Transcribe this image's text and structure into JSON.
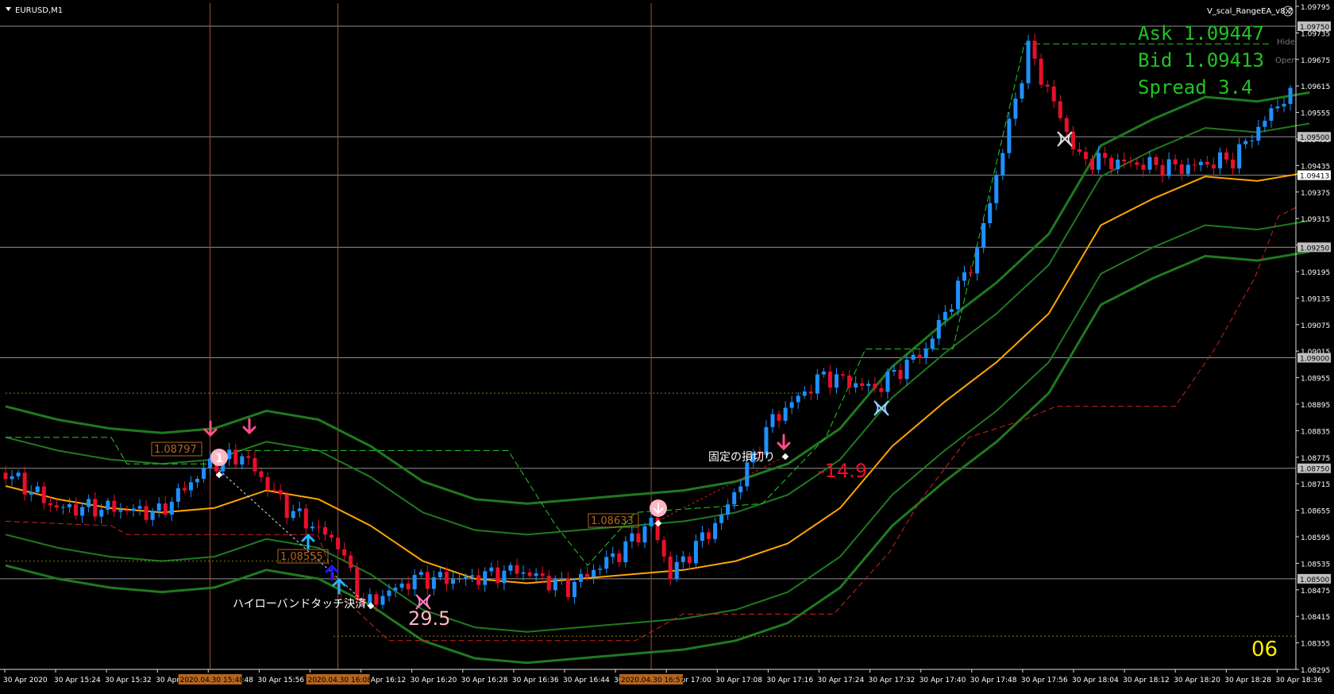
{
  "window": {
    "symbol_title": "EURUSD,M1",
    "ea_title": "V_scal_RangeEA_v8.2",
    "close_icon": "close-circle-icon",
    "menu_icon": "triangle-down-icon"
  },
  "quote": {
    "ask": "Ask 1.09447",
    "bid": "Bid 1.09413",
    "spread": "Spread 3.4",
    "hide_label": "Hide",
    "open_label": "Open"
  },
  "corner_number": "06",
  "colors": {
    "background": "#000000",
    "up_candle": "#1e90ff",
    "down_candle": "#e8102a",
    "middle_band": "#ffa500",
    "bands": "#1f7a1f",
    "band_dash": "#22cc22",
    "stop_dash": "#cc2222",
    "quote_text": "#22c322",
    "grid": "#bfbfbf",
    "vline": "#a0522d",
    "corner_number": "#ffee00"
  },
  "annotations": {
    "price_label_1": "1.08797",
    "price_label_2": "1.08555",
    "price_label_3": "1.08633",
    "hilo_text": "ハイローバンドタッチ決済",
    "stop_text": "固定の損切り",
    "profit_value": "29.5",
    "loss_value": "-14.9",
    "circle_1": "1"
  },
  "chart_data": {
    "type": "candlestick",
    "symbol": "EURUSD",
    "timeframe": "M1",
    "ylim": [
      1.08295,
      1.09795
    ],
    "price_ticks": [
      "1.09795",
      "1.09735",
      "1.09675",
      "1.09615",
      "1.09555",
      "1.09495",
      "1.09435",
      "1.09375",
      "1.09315",
      "1.09255",
      "1.09195",
      "1.09135",
      "1.09075",
      "1.09015",
      "1.08955",
      "1.08895",
      "1.08835",
      "1.08775",
      "1.08715",
      "1.08655",
      "1.08595",
      "1.08535",
      "1.08475",
      "1.08415",
      "1.08355",
      "1.08295"
    ],
    "horizontal_levels": [
      {
        "price": 1.0975,
        "label": "1.09750"
      },
      {
        "price": 1.095,
        "label": "1.09500"
      },
      {
        "price": 1.09413,
        "label": "1.09413"
      },
      {
        "price": 1.0925,
        "label": "1.09250"
      },
      {
        "price": 1.09,
        "label": "1.09000"
      },
      {
        "price": 1.0875,
        "label": "1.08750"
      },
      {
        "price": 1.085,
        "label": "1.08500"
      }
    ],
    "vertical_line_times": [
      {
        "time": "15:48",
        "label": "2020.04.30 15:48"
      },
      {
        "time": "16:08",
        "label": "2020.04.30 16:08"
      },
      {
        "time": "16:57",
        "label": "2020.04.30 16:57"
      }
    ],
    "time_labels": [
      "30 Apr 2020",
      "30 Apr 15:24",
      "30 Apr 15:32",
      "30 Apr 15:40",
      "30 Apr 15:48",
      "30 Apr 15:56",
      "30 Apr 16:04",
      "30 Apr 16:12",
      "30 Apr 16:20",
      "30 Apr 16:28",
      "30 Apr 16:36",
      "30 Apr 16:44",
      "30 Apr 16:52",
      "30 Apr 17:00",
      "30 Apr 17:08",
      "30 Apr 17:16",
      "30 Apr 17:24",
      "30 Apr 17:32",
      "30 Apr 17:40",
      "30 Apr 17:48",
      "30 Apr 17:56",
      "30 Apr 18:04",
      "30 Apr 18:12",
      "30 Apr 18:20",
      "30 Apr 18:28",
      "30 Apr 18:36"
    ],
    "close_path": [
      {
        "t": "15:16",
        "close": 1.0874
      },
      {
        "t": "15:24",
        "close": 1.0866
      },
      {
        "t": "15:32",
        "close": 1.0866
      },
      {
        "t": "15:40",
        "close": 1.0865
      },
      {
        "t": "15:48",
        "close": 1.0876
      },
      {
        "t": "15:53",
        "close": 1.0878
      },
      {
        "t": "16:00",
        "close": 1.0866
      },
      {
        "t": "16:08",
        "close": 1.0858
      },
      {
        "t": "16:12",
        "close": 1.0844
      },
      {
        "t": "16:20",
        "close": 1.085
      },
      {
        "t": "16:28",
        "close": 1.085
      },
      {
        "t": "16:36",
        "close": 1.0852
      },
      {
        "t": "16:44",
        "close": 1.0848
      },
      {
        "t": "16:52",
        "close": 1.0856
      },
      {
        "t": "16:57",
        "close": 1.0863
      },
      {
        "t": "17:00",
        "close": 1.0851
      },
      {
        "t": "17:08",
        "close": 1.0864
      },
      {
        "t": "17:16",
        "close": 1.0886
      },
      {
        "t": "17:24",
        "close": 1.0896
      },
      {
        "t": "17:32",
        "close": 1.0893
      },
      {
        "t": "17:40",
        "close": 1.0902
      },
      {
        "t": "17:48",
        "close": 1.0924
      },
      {
        "t": "17:56",
        "close": 1.097
      },
      {
        "t": "18:04",
        "close": 1.0945
      },
      {
        "t": "18:12",
        "close": 1.0944
      },
      {
        "t": "18:20",
        "close": 1.0943
      },
      {
        "t": "18:28",
        "close": 1.0945
      },
      {
        "t": "18:36",
        "close": 1.0959
      }
    ],
    "series": [
      {
        "name": "",
        "role": "middle-band",
        "color": "#ffa500",
        "values": [
          1.0871,
          1.0868,
          1.0866,
          1.0865,
          1.0866,
          1.087,
          1.0868,
          1.0862,
          1.0854,
          1.085,
          1.0849,
          1.085,
          1.0851,
          1.0852,
          1.0854,
          1.0858,
          1.0866,
          1.088,
          1.089,
          1.0899,
          1.091,
          1.093,
          1.0936,
          1.0941,
          1.094,
          1.0942
        ]
      }
    ]
  }
}
